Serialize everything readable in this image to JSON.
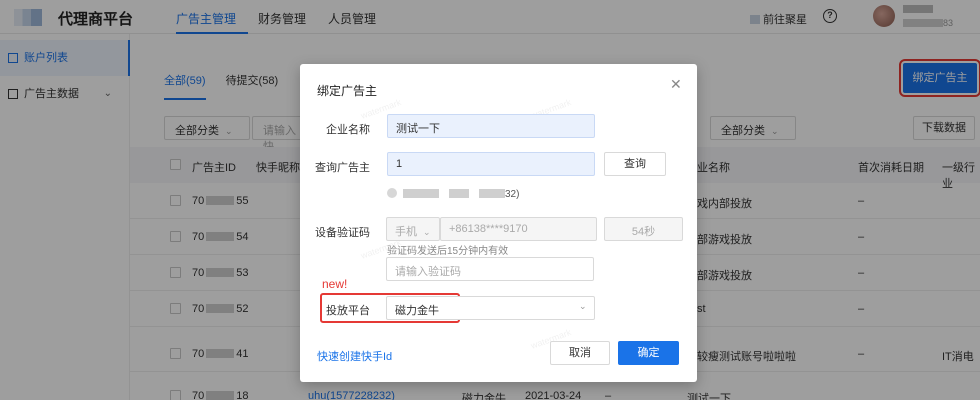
{
  "app": {
    "title": "代理商平台",
    "goto": "前往聚星",
    "user_id_suffix": "83"
  },
  "topnav": {
    "items": [
      "广告主管理",
      "财务管理",
      "人员管理"
    ],
    "active": 0
  },
  "sidebar": {
    "items": [
      {
        "label": "账户列表"
      },
      {
        "label": "广告主数据"
      }
    ]
  },
  "main": {
    "tabs": [
      "全部(59)",
      "待提交(58)"
    ],
    "bind_button": "绑定广告主",
    "filters": {
      "category_a": "全部分类",
      "search_placeholder": "请输入快",
      "category_b": "全部分类"
    },
    "download_button": "下载数据",
    "columns": [
      "广告主ID",
      "快手昵称",
      "业名称",
      "首次消耗日期",
      "一级行业"
    ],
    "rows": [
      {
        "id_a": "70",
        "id_b": "55",
        "name_tail": "戏内部投放",
        "date": "–",
        "industry": ""
      },
      {
        "id_a": "70",
        "id_b": "54",
        "name_tail": "部游戏投放",
        "date": "–",
        "industry": ""
      },
      {
        "id_a": "70",
        "id_b": "53",
        "name_tail": "部游戏投放",
        "date": "–",
        "industry": ""
      },
      {
        "id_a": "70",
        "id_b": "52",
        "name_tail": "st",
        "date": "–",
        "industry": ""
      },
      {
        "id_a": "70",
        "id_b": "41",
        "name_tail": "较瘦测试账号啦啦啦",
        "date": "–",
        "industry": "IT消电"
      },
      {
        "id_a": "70",
        "id_b": "18",
        "nick": "uhu(1577228232)",
        "platform": "磁力金牛",
        "created": "2021-03-24",
        "dash": "–",
        "name_tail": "测试一下",
        "date": "",
        "industry": ""
      }
    ]
  },
  "modal": {
    "title": "绑定广告主",
    "company_label": "企业名称",
    "company_value": "测试一下",
    "query_label": "查询广告主",
    "query_value": "1",
    "query_button": "查询",
    "account_suffix": "32)",
    "device_label": "设备验证码",
    "device_type": "手机",
    "phone_value": "+86138****9170",
    "countdown": "54秒",
    "code_hint": "验证码发送后15分钟内有效",
    "code_placeholder": "请输入验证码",
    "new_tag": "new!",
    "platform_label": "投放平台",
    "platform_value": "磁力金牛",
    "quick_link": "快速创建快手Id",
    "cancel": "取消",
    "confirm": "确定"
  },
  "colors": {
    "accent": "#1a73e8",
    "highlight": "#e53935"
  }
}
